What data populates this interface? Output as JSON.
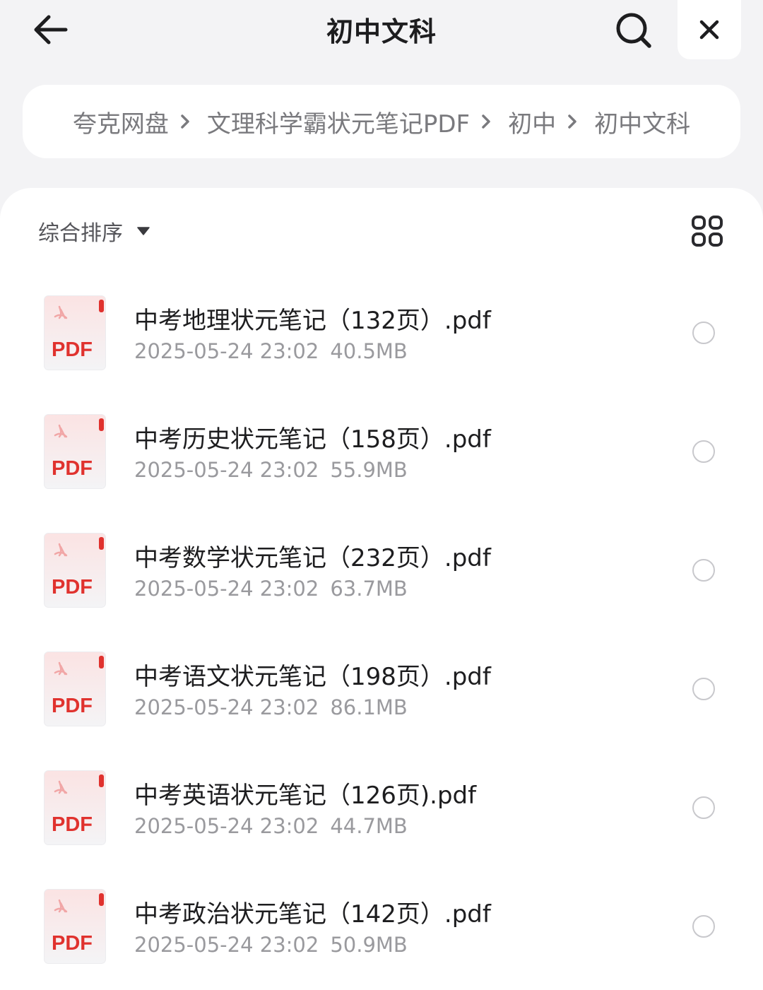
{
  "header": {
    "title": "初中文科",
    "icons": {
      "back": "arrow-left-icon",
      "search": "search-icon",
      "close": "close-icon"
    }
  },
  "breadcrumb": [
    "夸克网盘",
    "文理科学霸状元笔记PDF",
    "初中",
    "初中文科"
  ],
  "toolbar": {
    "sort_label": "综合排序",
    "sort_icon": "caret-down-icon",
    "view_toggle_icon": "grid-view-icon"
  },
  "file_badge": "PDF",
  "colors": {
    "pdf_red": "#e0322e",
    "accent": "#1d1d1f",
    "meta_gray": "#9a9a9e"
  },
  "files": [
    {
      "name": "中考地理状元笔记（132页）.pdf",
      "date": "2025-05-24 23:02",
      "size": "40.5MB"
    },
    {
      "name": "中考历史状元笔记（158页）.pdf",
      "date": "2025-05-24 23:02",
      "size": "55.9MB"
    },
    {
      "name": "中考数学状元笔记（232页）.pdf",
      "date": "2025-05-24 23:02",
      "size": "63.7MB"
    },
    {
      "name": "中考语文状元笔记（198页）.pdf",
      "date": "2025-05-24 23:02",
      "size": "86.1MB"
    },
    {
      "name": "中考英语状元笔记（126页).pdf",
      "date": "2025-05-24 23:02",
      "size": "44.7MB"
    },
    {
      "name": "中考政治状元笔记（142页）.pdf",
      "date": "2025-05-24 23:02",
      "size": "50.9MB"
    }
  ]
}
